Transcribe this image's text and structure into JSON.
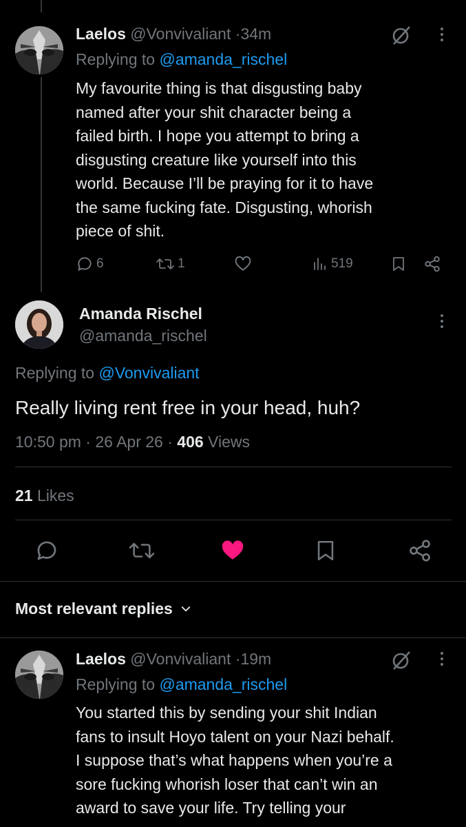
{
  "reply1": {
    "name": "Laelos",
    "handle": "@Vonvivaliant",
    "time": "34m",
    "replying_label": "Replying to",
    "replying_handle": "@amanda_rischel",
    "lines": [
      "My favourite thing is that disgusting baby",
      "named after your shit character being a",
      "failed birth. I hope you attempt to bring a",
      "disgusting creature like yourself into this",
      "world. Because I’ll be praying for it to have",
      "the same fucking fate. Disgusting, whorish",
      "piece of shit."
    ],
    "replies": "6",
    "reposts": "1",
    "views": "519"
  },
  "main": {
    "name": "Amanda Rischel",
    "handle": "@amanda_rischel",
    "replying_label": "Replying to",
    "replying_handle": "@Vonvivaliant",
    "text": "Really living rent free in your head, huh?",
    "time": "10:50 pm",
    "date": "26 Apr 26",
    "views_count": "406",
    "views_label": "Views",
    "likes_count": "21",
    "likes_label": "Likes"
  },
  "sort": {
    "label": "Most relevant replies"
  },
  "reply2": {
    "name": "Laelos",
    "handle": "@Vonvivaliant",
    "time": "19m",
    "replying_label": "Replying to",
    "replying_handle": "@amanda_rischel",
    "lines": [
      "You started this by sending your shit Indian",
      "fans to insult Hoyo talent on your Nazi behalf.",
      "I suppose that’s what happens when you’re a",
      "sore fucking whorish loser that can’t win an",
      "award to save your life. Try telling your"
    ]
  },
  "colors": {
    "like": "#f91880",
    "link": "#1d9bf0",
    "muted": "#71767b",
    "divider": "#2f3336"
  }
}
